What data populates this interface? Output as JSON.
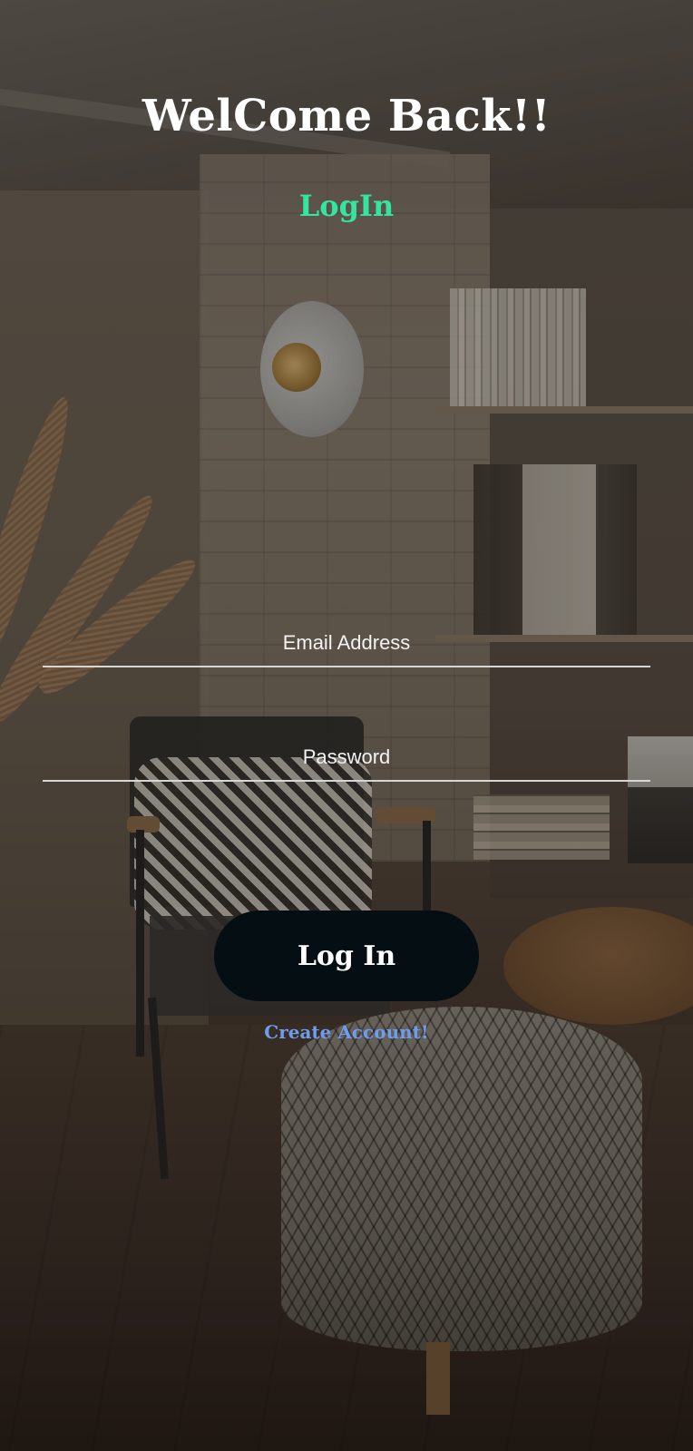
{
  "app": {
    "title": "WelCome Back!!",
    "subtitle": "LogIn"
  },
  "form": {
    "email": {
      "placeholder": "Email Address",
      "value": ""
    },
    "password": {
      "placeholder": "Password",
      "value": ""
    },
    "login_label": "Log In",
    "create_account_label": "Create Account!"
  },
  "colors": {
    "subtitle": "#34e4a0",
    "button_bg": "#040e13",
    "link": "#6e9cf0",
    "underline": "#d6d6d6"
  }
}
